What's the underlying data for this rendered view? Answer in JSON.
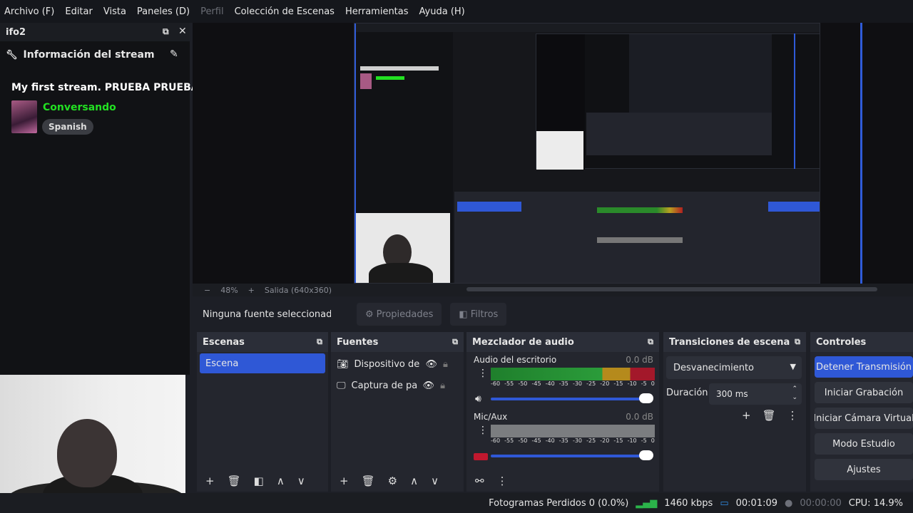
{
  "menubar": {
    "items": [
      "Archivo (F)",
      "Editar",
      "Vista",
      "Paneles (D)",
      "Perfil",
      "Colección de Escenas",
      "Herramientas",
      "Ayuda (H)"
    ],
    "disabled_index": 4
  },
  "left_dock": {
    "title": "ifo2",
    "header": "Información del stream",
    "stream_title": "My first stream. PRUEBA PRUEBA",
    "category": "Conversando",
    "language": "Spanish"
  },
  "preview_status": {
    "zoom": "48%",
    "output": "Salida (640x360)"
  },
  "source_toolbar": {
    "no_source": "Ninguna fuente seleccionad",
    "properties": "Propiedades",
    "filters": "Filtros"
  },
  "scenes": {
    "title": "Escenas",
    "items": [
      "Escena"
    ]
  },
  "sources": {
    "title": "Fuentes",
    "items": [
      {
        "label": "Dispositivo de v",
        "icon": "camera-icon"
      },
      {
        "label": "Captura de par",
        "icon": "monitor-icon"
      }
    ]
  },
  "mixer": {
    "title": "Mezclador de audio",
    "channels": [
      {
        "name": "Audio del escritorio",
        "db": "0.0 dB"
      },
      {
        "name": "Mic/Aux",
        "db": "0.0 dB"
      }
    ],
    "scale": [
      "-60",
      "-55",
      "-50",
      "-45",
      "-40",
      "-35",
      "-30",
      "-25",
      "-20",
      "-15",
      "-10",
      "-5",
      "0"
    ]
  },
  "transitions": {
    "title": "Transiciones de escena",
    "selected": "Desvanecimiento",
    "duration_label": "Duración",
    "duration_value": "300 ms"
  },
  "controls": {
    "title": "Controles",
    "buttons": [
      "Detener Transmisión",
      "Iniciar Grabación",
      "Iniciar Cámara Virtual",
      "Modo Estudio",
      "Ajustes"
    ]
  },
  "statusbar": {
    "dropped": "Fotogramas Perdidos 0 (0.0%)",
    "bitrate": "1460 kbps",
    "stream_time": "00:01:09",
    "rec_time": "00:00:00",
    "cpu": "CPU: 14.9%"
  },
  "colors": {
    "accent": "#2f58d6",
    "live_green": "#22e022"
  }
}
